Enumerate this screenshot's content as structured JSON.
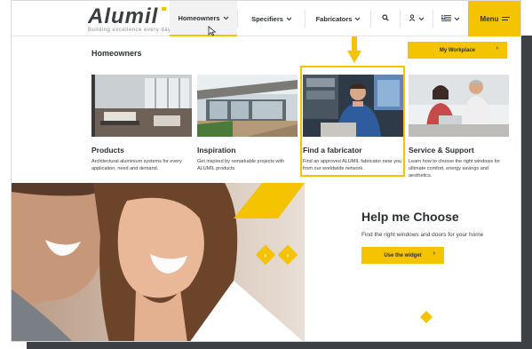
{
  "brand": {
    "name": "Alumil",
    "tagline": "Building excellence every day"
  },
  "nav": {
    "items": [
      {
        "label": "Homeowners",
        "chevron": "⌄"
      },
      {
        "label": "Specifiers",
        "chevron": "⌄"
      },
      {
        "label": "Fabricators",
        "chevron": "⌄"
      }
    ],
    "search_icon": "search-icon",
    "user_icon": "user-icon",
    "language_icon": "flag-icon",
    "menu_label": "Menu"
  },
  "panel": {
    "title": "Homeowners",
    "workplace_label": "My Workplace",
    "cards": [
      {
        "title": "Products",
        "desc": "Architectural aluminium systems for every application, need and demand."
      },
      {
        "title": "Inspiration",
        "desc": "Get inspired by remarkable projects with ALUMIL products"
      },
      {
        "title": "Find a fabricator",
        "desc": "Find an approved ALUMIL fabricator near you from our worldwide network."
      },
      {
        "title": "Service & Support",
        "desc": "Learn how to choose the right windows for ultimate comfort, energy savings and aesthetics."
      }
    ]
  },
  "hero": {
    "title": "Help me Choose",
    "subtitle": "Find the right windows and doors for your home",
    "button_label": "Use the widget",
    "prev": "‹",
    "next": "›"
  },
  "colors": {
    "accent": "#f5c400",
    "text": "#2b2f33",
    "frame": "#3d4146"
  }
}
